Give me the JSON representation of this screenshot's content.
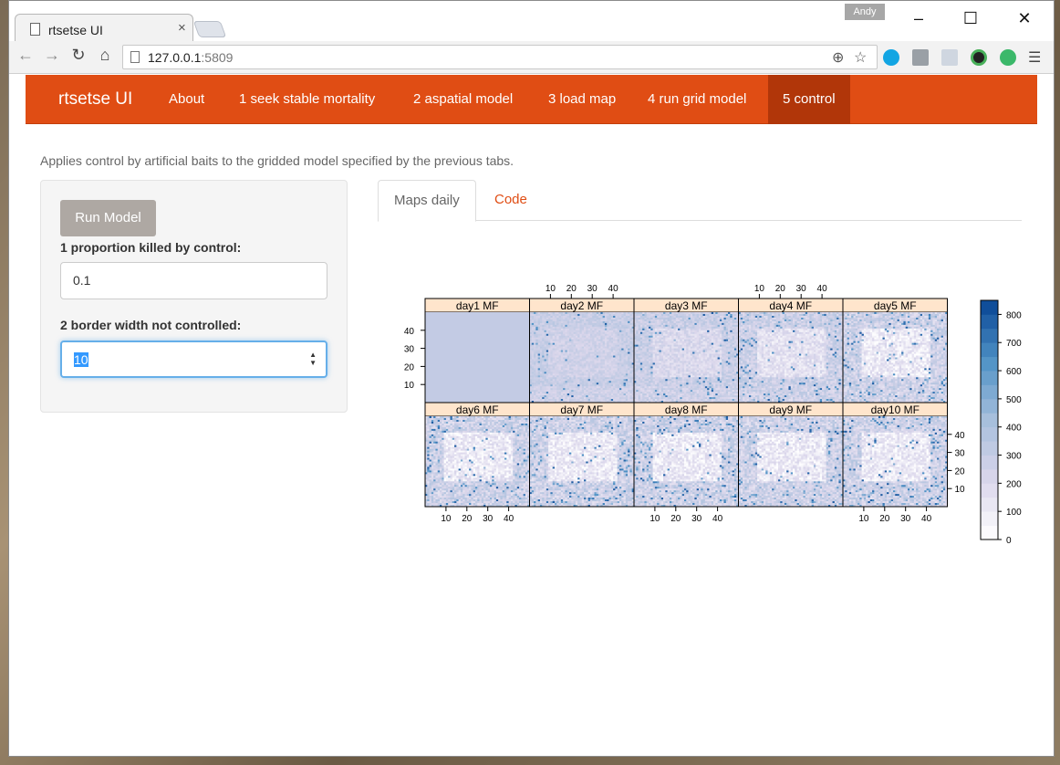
{
  "browser": {
    "tab_title": "rtsetse UI",
    "user_badge": "Andy",
    "url_host": "127.0.0.1",
    "url_port": ":5809"
  },
  "app": {
    "brand": "rtsetse UI",
    "nav": [
      {
        "label": "About"
      },
      {
        "label": "1 seek stable mortality"
      },
      {
        "label": "2 aspatial model"
      },
      {
        "label": "3 load map"
      },
      {
        "label": "4 run grid model"
      },
      {
        "label": "5 control",
        "active": true
      }
    ],
    "accent_color": "#e04d14",
    "description": "Applies control by artificial baits to the gridded model specified by the previous tabs."
  },
  "sidebar": {
    "run_button": "Run Model",
    "field1_label": "1 proportion killed by control:",
    "field1_value": "0.1",
    "field2_label": "2 border width not controlled:",
    "field2_value": "10"
  },
  "tabs": [
    {
      "label": "Maps daily",
      "active": true
    },
    {
      "label": "Code",
      "active": false
    }
  ],
  "chart_data": {
    "type": "heatmap",
    "panels": [
      "day1 MF",
      "day2 MF",
      "day3 MF",
      "day4 MF",
      "day5 MF",
      "day6 MF",
      "day7 MF",
      "day8 MF",
      "day9 MF",
      "day10 MF"
    ],
    "layout": "5 columns x 2 rows",
    "x_ticks": [
      10,
      20,
      30,
      40
    ],
    "y_ticks": [
      10,
      20,
      30,
      40
    ],
    "xlim": [
      1,
      50
    ],
    "ylim": [
      1,
      50
    ],
    "colorbar_ticks": [
      0,
      100,
      200,
      300,
      400,
      500,
      600,
      700,
      800
    ],
    "colorbar_range": [
      0,
      850
    ],
    "colors": [
      "#ffffff",
      "#dad6eb",
      "#a7bfdc",
      "#4f92c6",
      "#084594"
    ]
  }
}
